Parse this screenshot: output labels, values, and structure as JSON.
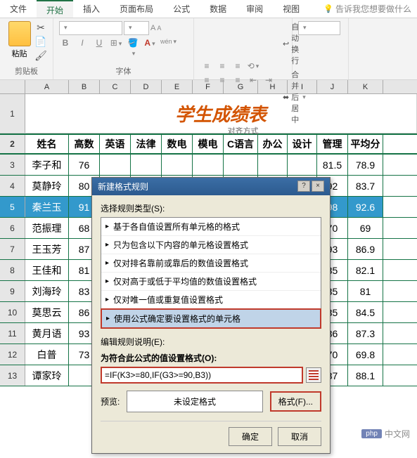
{
  "tabs": [
    "文件",
    "开始",
    "插入",
    "页面布局",
    "公式",
    "数据",
    "审阅",
    "视图"
  ],
  "active_tab": 1,
  "tell_me": "告诉我您想要做什么",
  "ribbon": {
    "paste": "粘贴",
    "clipboard_label": "剪贴板",
    "font_label": "字体",
    "align_label": "对齐方式",
    "wrap": "自动换行",
    "merge": "合并后居中",
    "tiny_a": "A",
    "tiny_a2": "A",
    "wen": "wén"
  },
  "columns": [
    "A",
    "B",
    "C",
    "D",
    "E",
    "F",
    "G",
    "H",
    "I",
    "J",
    "K"
  ],
  "title": "学生成绩表",
  "headers": [
    "姓名",
    "高数",
    "英语",
    "法律",
    "数电",
    "模电",
    "C语言",
    "办公",
    "设计",
    "管理",
    "平均分"
  ],
  "rows": [
    {
      "n": "3",
      "name": "李子和",
      "b": "76",
      "j": "81.5",
      "k": "78.9"
    },
    {
      "n": "4",
      "name": "莫静玲",
      "b": "80",
      "j": "92",
      "k": "83.7"
    },
    {
      "n": "5",
      "name": "秦兰玉",
      "b": "91",
      "j": "98",
      "k": "92.6",
      "sel": true
    },
    {
      "n": "6",
      "name": "范振理",
      "b": "68",
      "j": "70",
      "k": "69"
    },
    {
      "n": "7",
      "name": "王玉芳",
      "b": "87",
      "j": "93",
      "k": "86.9"
    },
    {
      "n": "8",
      "name": "王佳和",
      "b": "81",
      "j": "85",
      "k": "82.1"
    },
    {
      "n": "9",
      "name": "刘海玲",
      "b": "83",
      "j": "85",
      "k": "81"
    },
    {
      "n": "10",
      "name": "莫思云",
      "b": "86",
      "j": "85",
      "k": "84.5"
    },
    {
      "n": "11",
      "name": "黄月语",
      "b": "93",
      "j": "86",
      "k": "87.3"
    },
    {
      "n": "12",
      "name": "白普",
      "b": "73",
      "j": "70",
      "k": "69.8"
    },
    {
      "n": "13",
      "name": "谭家玲",
      "b": "",
      "j": "87",
      "k": "88.1"
    }
  ],
  "dialog": {
    "title": "新建格式规则",
    "section1": "选择规则类型(S):",
    "rules": [
      "基于各自值设置所有单元格的格式",
      "只为包含以下内容的单元格设置格式",
      "仅对排名靠前或靠后的数值设置格式",
      "仅对高于或低于平均值的数值设置格式",
      "仅对唯一值或重复值设置格式",
      "使用公式确定要设置格式的单元格"
    ],
    "selected_rule": 5,
    "section2": "编辑规则说明(E):",
    "formula_label": "为符合此公式的值设置格式(O):",
    "formula": "=IF(K3>=80,IF(G3>=90,B3))",
    "preview_label": "预览:",
    "preview_text": "未设定格式",
    "format_btn": "格式(F)...",
    "ok": "确定",
    "cancel": "取消",
    "help": "?",
    "close": "×"
  },
  "watermark": "中文网"
}
